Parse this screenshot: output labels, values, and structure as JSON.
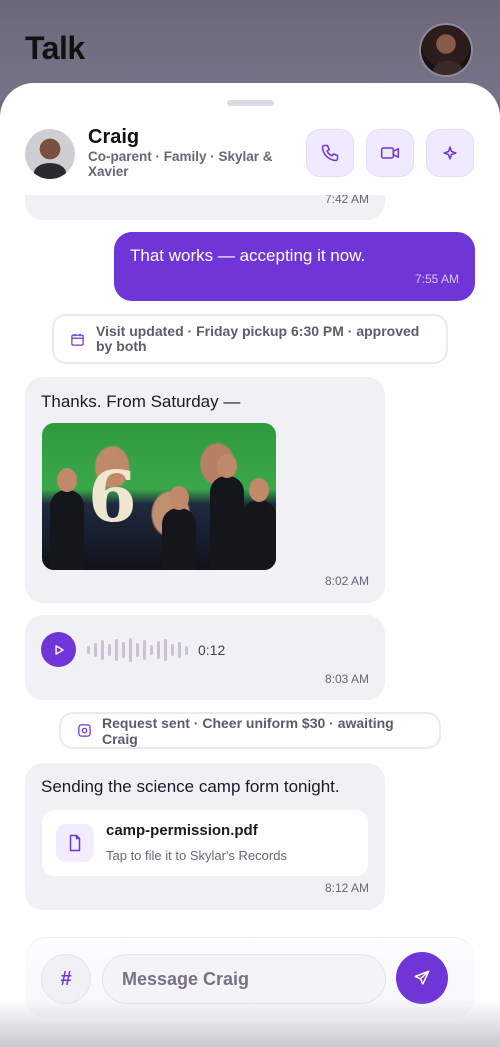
{
  "app": {
    "title": "Talk"
  },
  "contact": {
    "name": "Craig",
    "meta": "Co-parent · Family · Skylar & Xavier"
  },
  "header_actions": [
    {
      "icon": "phone-icon",
      "label": ""
    },
    {
      "icon": "video-icon",
      "label": ""
    },
    {
      "icon": "sparkle-icon",
      "label": ""
    }
  ],
  "messages": {
    "m0": {
      "time": "7:42 AM"
    },
    "m1": {
      "text": "That works — accepting it now.",
      "time": "7:55 AM"
    },
    "event1": {
      "icon": "calendar-icon",
      "text": "Visit updated · Friday pickup 6:30 PM · approved by both"
    },
    "m2": {
      "text": "Thanks. From Saturday —",
      "time": "8:02 AM",
      "photo_overlay": "6"
    },
    "m3": {
      "duration": "0:12",
      "time": "8:03 AM"
    },
    "event2": {
      "icon": "request-icon",
      "text": "Request sent · Cheer uniform $30 · awaiting Craig"
    },
    "m4": {
      "text": "Sending the science camp form tonight.",
      "time": "8:12 AM",
      "file": {
        "name": "camp-permission.pdf",
        "subtitle": "Tap to file it to Skylar's Records"
      }
    }
  },
  "composer": {
    "hash_label": "#",
    "placeholder": "Message Craig",
    "value": ""
  },
  "colors": {
    "accent": "#6f35d6",
    "bubble_in": "#f1f0f5",
    "accent_soft": "#efeaff"
  }
}
